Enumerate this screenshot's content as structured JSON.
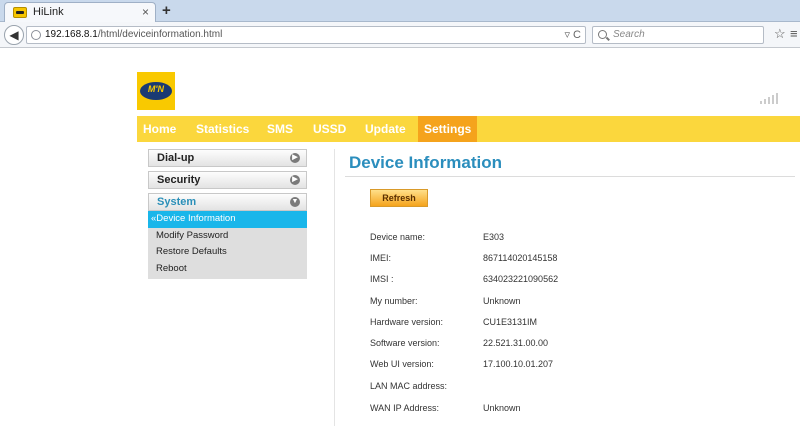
{
  "browser": {
    "tab_title": "HiLink",
    "tab_close": "×",
    "new_tab": "+",
    "url_host": "192.168.8.1",
    "url_path": "/html/deviceinformation.html",
    "url_controls": "▿ C",
    "search_placeholder": "Search",
    "back_glyph": "◀",
    "star_glyph": "☆",
    "menu_glyph": "≡"
  },
  "brand": {
    "logo_text": "M'N",
    "primary_color": "#fbd73d",
    "active_color": "#f5a31c"
  },
  "nav": {
    "items": [
      "Home",
      "Statistics",
      "SMS",
      "USSD",
      "Update",
      "Settings"
    ],
    "active": "Settings"
  },
  "sidebar": {
    "sections": [
      {
        "label": "Dial-up",
        "arrow": "▶"
      },
      {
        "label": "Security",
        "arrow": "▶"
      },
      {
        "label": "System",
        "arrow": "▼"
      }
    ],
    "system_items": [
      "Device Information",
      "Modify Password",
      "Restore Defaults",
      "Reboot"
    ],
    "active_prefix": "«"
  },
  "main": {
    "title": "Device Information",
    "refresh_label": "Refresh",
    "info": [
      {
        "label": "Device name:",
        "value": "E303"
      },
      {
        "label": "IMEI:",
        "value": "867114020145158"
      },
      {
        "label": "IMSI :",
        "value": "634023221090562"
      },
      {
        "label": "My number:",
        "value": "Unknown"
      },
      {
        "label": "Hardware version:",
        "value": "CU1E3131IM"
      },
      {
        "label": "Software version:",
        "value": "22.521.31.00.00"
      },
      {
        "label": "Web UI version:",
        "value": "17.100.10.01.207"
      },
      {
        "label": "LAN MAC address:",
        "value": ""
      },
      {
        "label": "WAN IP Address:",
        "value": "Unknown"
      }
    ]
  }
}
